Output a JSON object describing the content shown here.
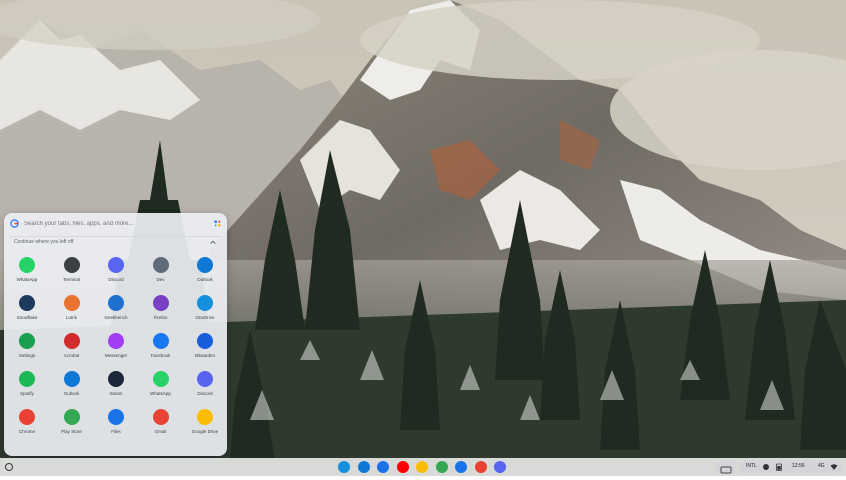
{
  "search": {
    "placeholder": "Search your tabs, files, apps, and more..."
  },
  "continue_label": "Continue where you left off",
  "apps": [
    {
      "label": "WhatsApp",
      "icon": "whatsapp-icon",
      "color": "#25d366"
    },
    {
      "label": "Terminal",
      "icon": "terminal-icon",
      "color": "#3c4043"
    },
    {
      "label": "Discord",
      "icon": "discord-icon",
      "color": "#5865f2"
    },
    {
      "label": "Dev",
      "icon": "dev-icon",
      "color": "#5f6b7a"
    },
    {
      "label": "Outlook",
      "icon": "outlook-icon",
      "color": "#0f78d4"
    },
    {
      "label": "Snowflake",
      "icon": "snowflake-icon",
      "color": "#1d3a5e"
    },
    {
      "label": "Lutris",
      "icon": "lutris-icon",
      "color": "#e8742f"
    },
    {
      "label": "Geekbench",
      "icon": "geekbench-icon",
      "color": "#1f6fd1"
    },
    {
      "label": "Firefox",
      "icon": "firefox-icon",
      "color": "#7a3fc2"
    },
    {
      "label": "OneDrive",
      "icon": "onedrive-icon",
      "color": "#1490df"
    },
    {
      "label": "Settings",
      "icon": "settings-icon",
      "color": "#1a9e4f"
    },
    {
      "label": "Acrobat",
      "icon": "acrobat-icon",
      "color": "#d12b2b"
    },
    {
      "label": "Messenger",
      "icon": "messenger-icon",
      "color": "#a23cf5"
    },
    {
      "label": "Facebook",
      "icon": "facebook-icon",
      "color": "#1877f2"
    },
    {
      "label": "Bitwarden",
      "icon": "bitwarden-icon",
      "color": "#175ddc"
    },
    {
      "label": "Spotify",
      "icon": "spotify-icon",
      "color": "#1db954"
    },
    {
      "label": "Outlook",
      "icon": "outlook-alt-icon",
      "color": "#0f78d4"
    },
    {
      "label": "Steam",
      "icon": "steam-icon",
      "color": "#1b2838"
    },
    {
      "label": "WhatsApp",
      "icon": "whatsapp-alt-icon",
      "color": "#25d366"
    },
    {
      "label": "Discord",
      "icon": "discord-alt-icon",
      "color": "#5865f2"
    },
    {
      "label": "Chrome",
      "icon": "chrome-icon",
      "color": "#e94235"
    },
    {
      "label": "Play Store",
      "icon": "play-store-icon",
      "color": "#34a853"
    },
    {
      "label": "Files",
      "icon": "files-icon",
      "color": "#1a73e8"
    },
    {
      "label": "Gmail",
      "icon": "gmail-icon",
      "color": "#ea4335"
    },
    {
      "label": "Google Drive",
      "icon": "google-drive-icon",
      "color": "#fbbc04"
    }
  ],
  "shelf_apps": [
    {
      "icon": "onedrive-shelf-icon",
      "color": "#1490df"
    },
    {
      "icon": "outlook-shelf-icon",
      "color": "#0f78d4"
    },
    {
      "icon": "messages-shelf-icon",
      "color": "#1a73e8"
    },
    {
      "icon": "youtube-shelf-icon",
      "color": "#ff0000"
    },
    {
      "icon": "photos-shelf-icon",
      "color": "#fbbc04"
    },
    {
      "icon": "play-shelf-icon",
      "color": "#34a853"
    },
    {
      "icon": "files-shelf-icon",
      "color": "#1a73e8"
    },
    {
      "icon": "chrome-shelf-icon",
      "color": "#e94235"
    },
    {
      "icon": "discord-shelf-icon",
      "color": "#5865f2"
    }
  ],
  "tray": {
    "keyboard": "INTL",
    "time": "12:56",
    "network": "4G"
  }
}
